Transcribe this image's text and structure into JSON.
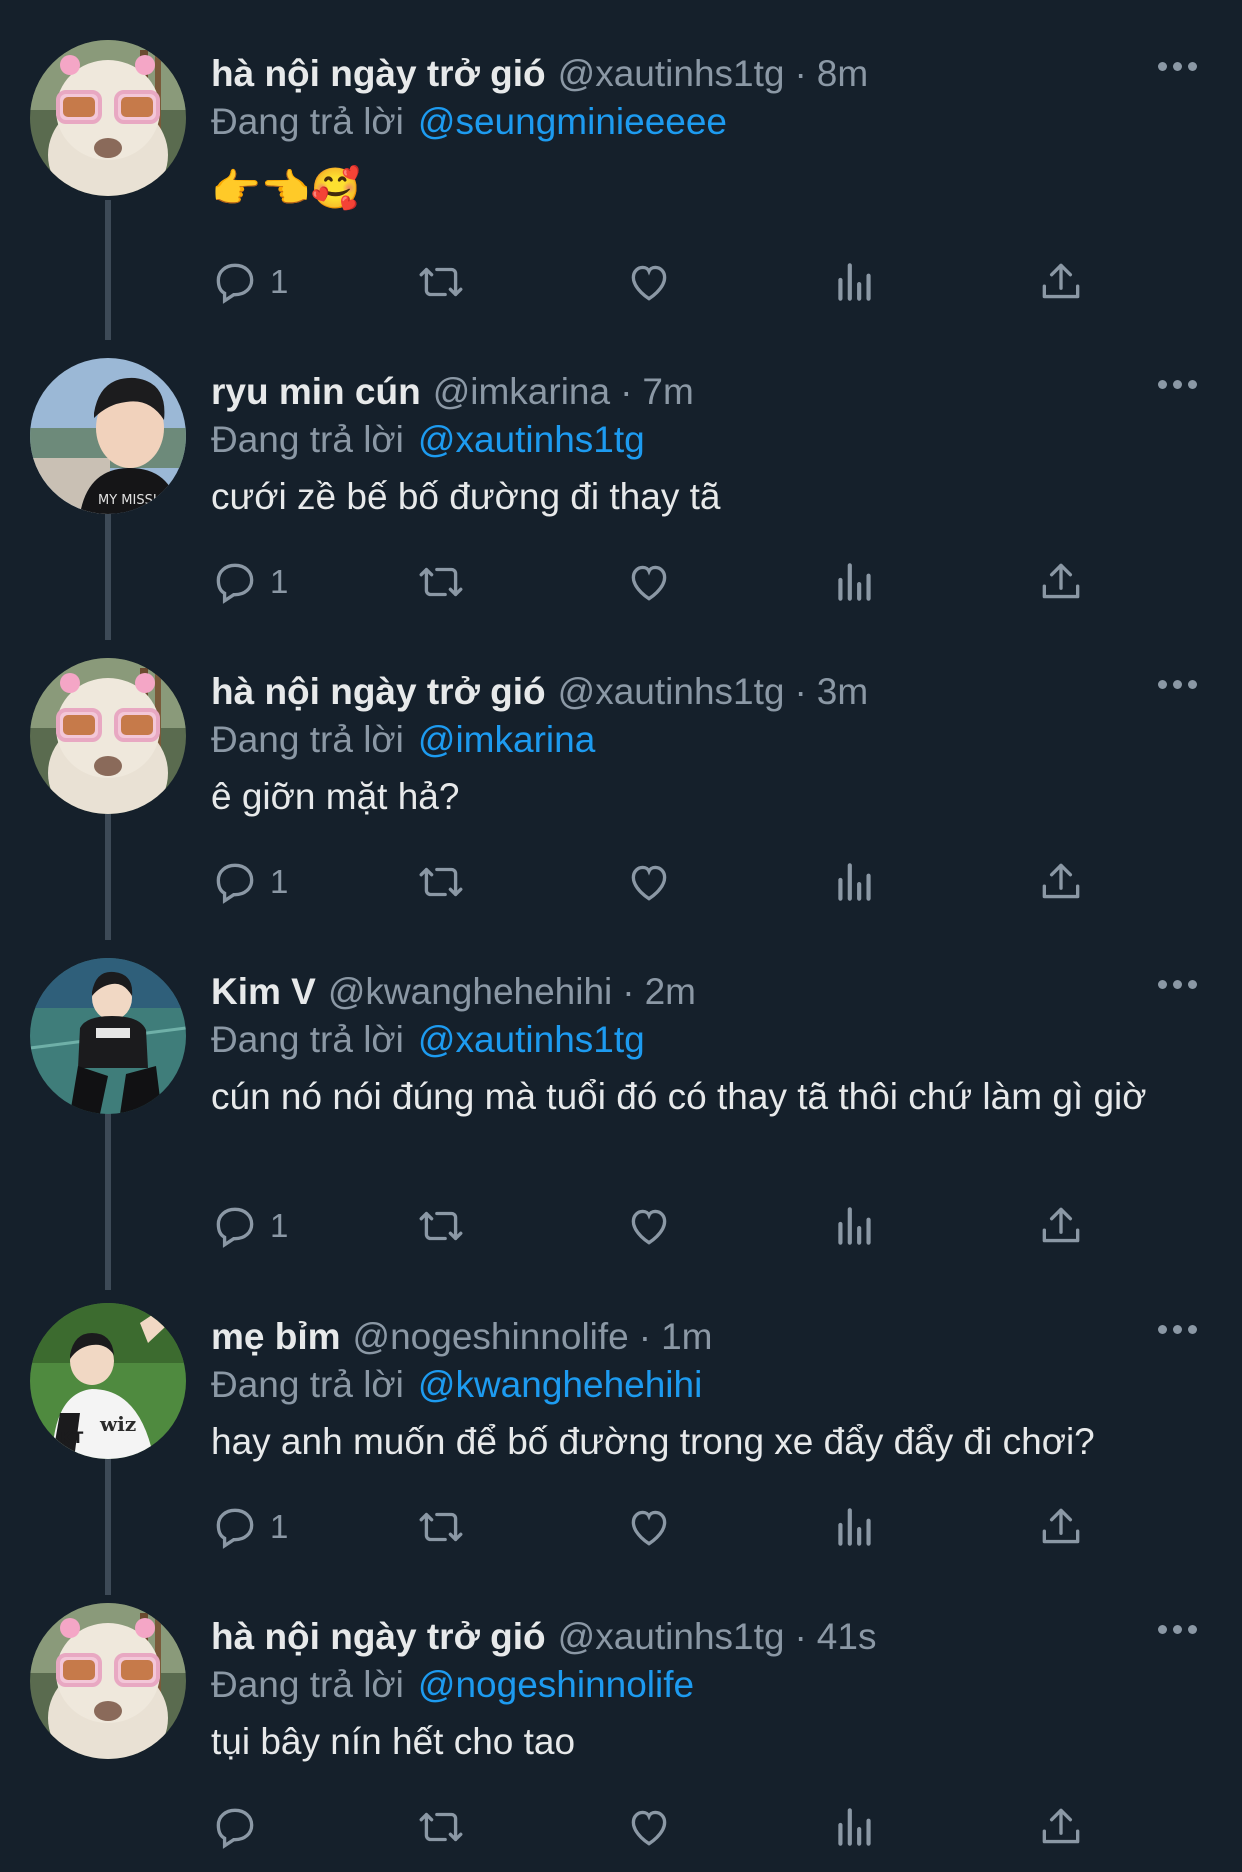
{
  "tweets": [
    {
      "name": "hà nội ngày trở gió",
      "handle": "@xautinhs1tg",
      "time": "8m",
      "reply_prefix": "Đang trả lời",
      "reply_to": "@seungminieeeee",
      "text": "👉👈🥰",
      "reply_count": "1",
      "avatar": "alpaca-sunglasses"
    },
    {
      "name": "ryu min cún",
      "handle": "@imkarina",
      "time": "7m",
      "reply_prefix": "Đang trả lời",
      "reply_to": "@xautinhs1tg",
      "text": "cưới zề bế bố đường đi thay tã",
      "reply_count": "1",
      "avatar": "person-dark-hair"
    },
    {
      "name": "hà nội ngày trở gió",
      "handle": "@xautinhs1tg",
      "time": "3m",
      "reply_prefix": "Đang trả lời",
      "reply_to": "@imkarina",
      "text": "ê giỡn mặt hả?",
      "reply_count": "1",
      "avatar": "alpaca-sunglasses"
    },
    {
      "name": "Kim V",
      "handle": "@kwanghehehihi",
      "time": "2m",
      "reply_prefix": "Đang trả lời",
      "reply_to": "@xautinhs1tg",
      "text": "cún nó nói đúng mà tuổi đó có thay tã thôi chứ làm gì giờ",
      "reply_count": "1",
      "avatar": "person-crouching"
    },
    {
      "name": "mẹ bỉm",
      "handle": "@nogeshinnolife",
      "time": "1m",
      "reply_prefix": "Đang trả lời",
      "reply_to": "@kwanghehehihi",
      "text": "hay anh muốn để bố đường trong xe đẩy đẩy đi chơi?",
      "reply_count": "1",
      "avatar": "person-jersey"
    },
    {
      "name": "hà nội ngày trở gió",
      "handle": "@xautinhs1tg",
      "time": "41s",
      "reply_prefix": "Đang trả lời",
      "reply_to": "@nogeshinnolife",
      "text": "tụi bây nín hết cho tao",
      "reply_count": "",
      "avatar": "alpaca-sunglasses"
    }
  ],
  "icons": {
    "reply": "reply-icon",
    "retweet": "retweet-icon",
    "like": "like-icon",
    "views": "views-icon",
    "share": "share-icon",
    "more": "more-icon"
  },
  "colors": {
    "background": "#15202b",
    "text": "#e7e9ea",
    "secondary": "#8b98a5",
    "link": "#1d9bf0",
    "thread_line": "#3d4a57"
  }
}
